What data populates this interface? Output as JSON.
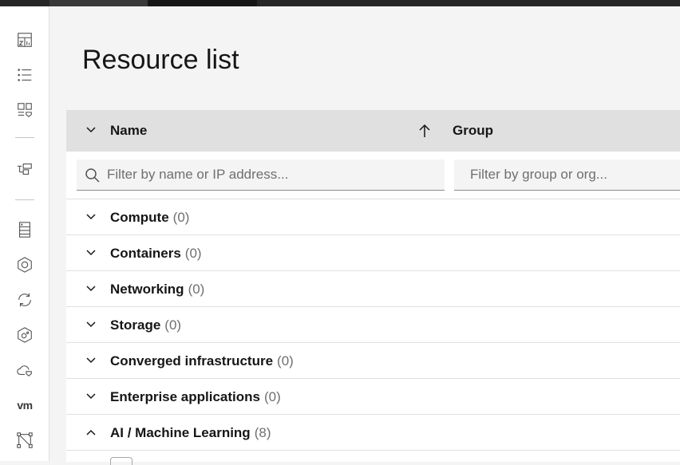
{
  "page": {
    "title": "Resource list"
  },
  "rail": {
    "items": [
      {
        "icon": "dashboard-icon"
      },
      {
        "icon": "list-icon"
      },
      {
        "icon": "cards-icon"
      },
      {
        "icon": "hierarchy-icon"
      },
      {
        "icon": "server-icon"
      },
      {
        "icon": "hexagon-icon"
      },
      {
        "icon": "sync-icon"
      },
      {
        "icon": "hexagon-settings-icon"
      },
      {
        "icon": "cloud-icon"
      },
      {
        "label": "vm"
      },
      {
        "icon": "network-icon"
      }
    ]
  },
  "table": {
    "columns": {
      "name": "Name",
      "group": "Group"
    },
    "filters": {
      "name_placeholder": "Filter by name or IP address...",
      "group_placeholder": "Filter by group or org..."
    },
    "groups": [
      {
        "label": "Compute",
        "count": "(0)",
        "expanded": false
      },
      {
        "label": "Containers",
        "count": "(0)",
        "expanded": false
      },
      {
        "label": "Networking",
        "count": "(0)",
        "expanded": false
      },
      {
        "label": "Storage",
        "count": "(0)",
        "expanded": false
      },
      {
        "label": "Converged infrastructure",
        "count": "(0)",
        "expanded": false
      },
      {
        "label": "Enterprise applications",
        "count": "(0)",
        "expanded": false
      },
      {
        "label": "AI / Machine Learning",
        "count": "(8)",
        "expanded": true
      }
    ]
  }
}
